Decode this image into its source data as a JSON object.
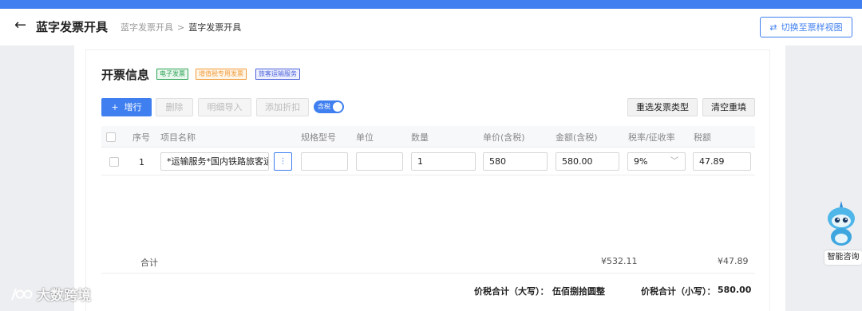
{
  "header": {
    "back_icon": "arrow-left-icon",
    "title": "蓝字发票开具",
    "breadcrumb": [
      "蓝字发票开具",
      "蓝字发票开具"
    ],
    "breadcrumb_sep": ">",
    "switch_label": "切换至票样视图",
    "switch_icon": "swap-icon"
  },
  "section": {
    "title": "开票信息",
    "tags": [
      "电子发票",
      "增值税专用发票",
      "旅客运输服务"
    ]
  },
  "toolbar": {
    "add_label": "增行",
    "add_icon": "+",
    "delete_label": "删除",
    "import_label": "明细导入",
    "discount_label": "添加折扣",
    "tax_toggle_label": "含税",
    "tax_toggle_on": true,
    "reselect_label": "重选发票类型",
    "clear_label": "清空重填"
  },
  "table": {
    "columns": [
      "序号",
      "项目名称",
      "规格型号",
      "单位",
      "数量",
      "单价(含税)",
      "金额(含税)",
      "税率/征收率",
      "税额"
    ],
    "rows": [
      {
        "index": "1",
        "item_name": "*运输服务*国内铁路旅客运",
        "spec": "",
        "unit": "",
        "quantity": "1",
        "unit_price": "580",
        "amount": "580.00",
        "tax_rate": "9%",
        "tax_amount": "47.89"
      }
    ]
  },
  "summary": {
    "label": "合计",
    "amount": "¥532.11",
    "tax": "¥47.89",
    "total_upper_label": "价税合计（大写）：",
    "total_upper_value": "伍佰捌拾圆整",
    "total_lower_label": "价税合计（小写）：",
    "total_lower_value": "580.00"
  },
  "assistant": {
    "label": "智能咨询"
  },
  "watermark": "大数跨境",
  "colors": {
    "accent": "#3f7ff0",
    "tag_green": "#2ea456",
    "tag_orange": "#f29a36",
    "tag_blue": "#4b61d8"
  }
}
